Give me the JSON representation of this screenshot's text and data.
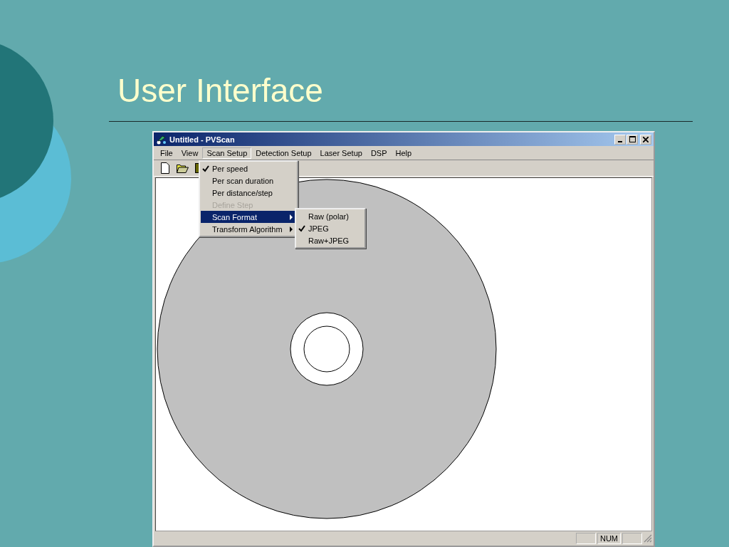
{
  "slide": {
    "title": "User Interface"
  },
  "window": {
    "title": "Untitled - PVScan"
  },
  "menu_bar": [
    {
      "label": "File",
      "selected": false
    },
    {
      "label": "View",
      "selected": false
    },
    {
      "label": "Scan Setup",
      "selected": true
    },
    {
      "label": "Detection Setup",
      "selected": false
    },
    {
      "label": "Laser Setup",
      "selected": false
    },
    {
      "label": "DSP",
      "selected": false
    },
    {
      "label": "Help",
      "selected": false
    }
  ],
  "dropdown": [
    {
      "label": "Per speed",
      "checked": true,
      "disabled": false,
      "selected": false,
      "submenu": false
    },
    {
      "label": "Per scan duration",
      "checked": false,
      "disabled": false,
      "selected": false,
      "submenu": false
    },
    {
      "label": "Per distance/step",
      "checked": false,
      "disabled": false,
      "selected": false,
      "submenu": false
    },
    {
      "label": "Define Step",
      "checked": false,
      "disabled": true,
      "selected": false,
      "submenu": false
    },
    {
      "label": "Scan Format",
      "checked": false,
      "disabled": false,
      "selected": true,
      "submenu": true
    },
    {
      "label": "Transform Algorithm",
      "checked": false,
      "disabled": false,
      "selected": false,
      "submenu": true
    }
  ],
  "submenu": [
    {
      "label": "Raw (polar)",
      "checked": false
    },
    {
      "label": "JPEG",
      "checked": true
    },
    {
      "label": "Raw+JPEG",
      "checked": false
    }
  ],
  "status_bar": {
    "indicator": "NUM"
  }
}
